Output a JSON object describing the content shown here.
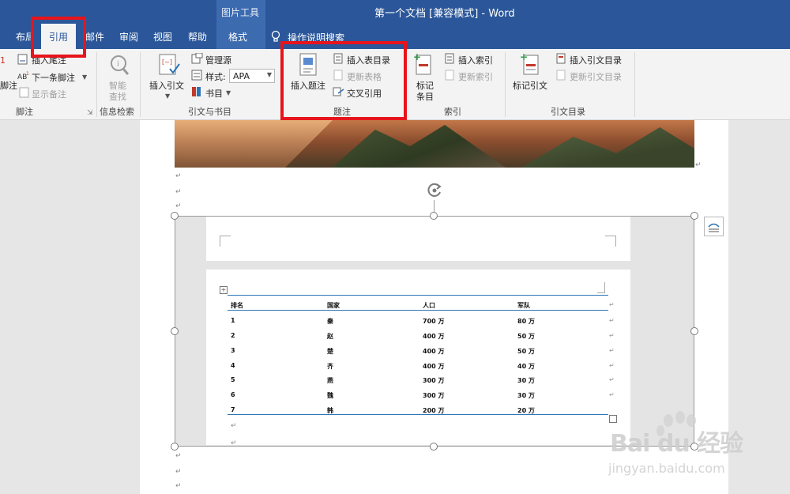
{
  "titlebar": {
    "contextual_tab_group": "图片工具",
    "window_title": "第一个文档 [兼容模式]  -  Word"
  },
  "tabs": [
    {
      "label": "布局",
      "active": false
    },
    {
      "label": "引用",
      "active": true
    },
    {
      "label": "邮件",
      "active": false
    },
    {
      "label": "审阅",
      "active": false
    },
    {
      "label": "视图",
      "active": false
    },
    {
      "label": "帮助",
      "active": false
    },
    {
      "label": "格式",
      "active": false
    }
  ],
  "tell_me": "操作说明搜索",
  "ribbon": {
    "footnotes": {
      "label": "脚注",
      "insert_endnote": "插入尾注",
      "next_footnote": "下一条脚注",
      "show_notes": "显示备注",
      "cut_label": "脚注",
      "cut_number": "1"
    },
    "research": {
      "label": "信息检索",
      "smart_lookup_line1": "智能",
      "smart_lookup_line2": "查找"
    },
    "citations": {
      "label": "引文与书目",
      "insert_citation": "插入引文",
      "manage_sources": "管理源",
      "style_label": "样式:",
      "style_value": "APA",
      "bibliography": "书目"
    },
    "captions": {
      "label": "题注",
      "insert_caption": "插入题注",
      "insert_table_of_figures": "插入表目录",
      "update_table": "更新表格",
      "cross_reference": "交叉引用"
    },
    "index": {
      "label": "索引",
      "mark_entry_line1": "标记",
      "mark_entry_line2": "条目",
      "insert_index": "插入索引",
      "update_index": "更新索引"
    },
    "table_of_authorities": {
      "label": "引文目录",
      "mark_citation": "标记引文",
      "insert_toa": "插入引文目录",
      "update_toa": "更新引文目录"
    }
  },
  "table": {
    "headers": [
      "排名",
      "国家",
      "人口",
      "军队"
    ],
    "rows": [
      [
        "1",
        "秦",
        "700 万",
        "80 万"
      ],
      [
        "2",
        "赵",
        "400 万",
        "50 万"
      ],
      [
        "3",
        "楚",
        "400 万",
        "50 万"
      ],
      [
        "4",
        "齐",
        "400 万",
        "40 万"
      ],
      [
        "5",
        "燕",
        "300 万",
        "30 万"
      ],
      [
        "6",
        "魏",
        "300 万",
        "30 万"
      ],
      [
        "7",
        "韩",
        "200 万",
        "20 万"
      ]
    ]
  },
  "watermark": {
    "text": "Bai du 经验",
    "url": "jingyan.baidu.com"
  },
  "colors": {
    "title_bar": "#2b579a",
    "ribbon": "#f3f3f3",
    "highlight": "#e8141b",
    "table_rule": "#2e74b5"
  }
}
